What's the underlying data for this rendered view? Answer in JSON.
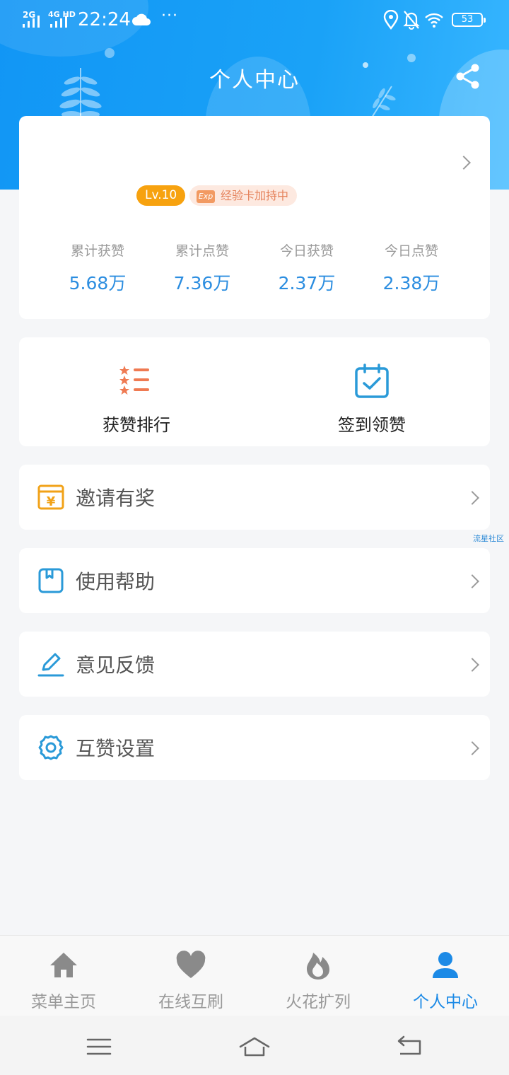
{
  "status_bar": {
    "signal_1": "2G",
    "signal_2": "4G HD",
    "time": "22:24",
    "more": "···",
    "battery": "53"
  },
  "header": {
    "title": "个人中心"
  },
  "profile": {
    "level": "Lv.10",
    "exp_badge": "Exp",
    "exp_text": "经验卡加持中",
    "stats": [
      {
        "label": "累计获赞",
        "value": "5.68万"
      },
      {
        "label": "累计点赞",
        "value": "7.36万"
      },
      {
        "label": "今日获赞",
        "value": "2.37万"
      },
      {
        "label": "今日点赞",
        "value": "2.38万"
      }
    ]
  },
  "quick_actions": [
    {
      "label": "获赞排行",
      "icon": "ranking-icon"
    },
    {
      "label": "签到领赞",
      "icon": "calendar-check-icon"
    }
  ],
  "menu": [
    {
      "label": "邀请有奖",
      "icon": "yuan-gift-icon"
    },
    {
      "label": "使用帮助",
      "icon": "book-icon"
    },
    {
      "label": "意见反馈",
      "icon": "edit-icon"
    },
    {
      "label": "互赞设置",
      "icon": "gear-icon"
    }
  ],
  "watermark": "流星社区",
  "tabbar": [
    {
      "label": "菜单主页",
      "icon": "home-icon",
      "active": false
    },
    {
      "label": "在线互刷",
      "icon": "heart-icon",
      "active": false
    },
    {
      "label": "火花扩列",
      "icon": "flame-icon",
      "active": false
    },
    {
      "label": "个人中心",
      "icon": "user-icon",
      "active": true
    }
  ],
  "colors": {
    "header_blue": "#1196f5",
    "accent_blue": "#2b8de0",
    "level_orange": "#f7a20f",
    "tab_active": "#1c8ae6"
  }
}
